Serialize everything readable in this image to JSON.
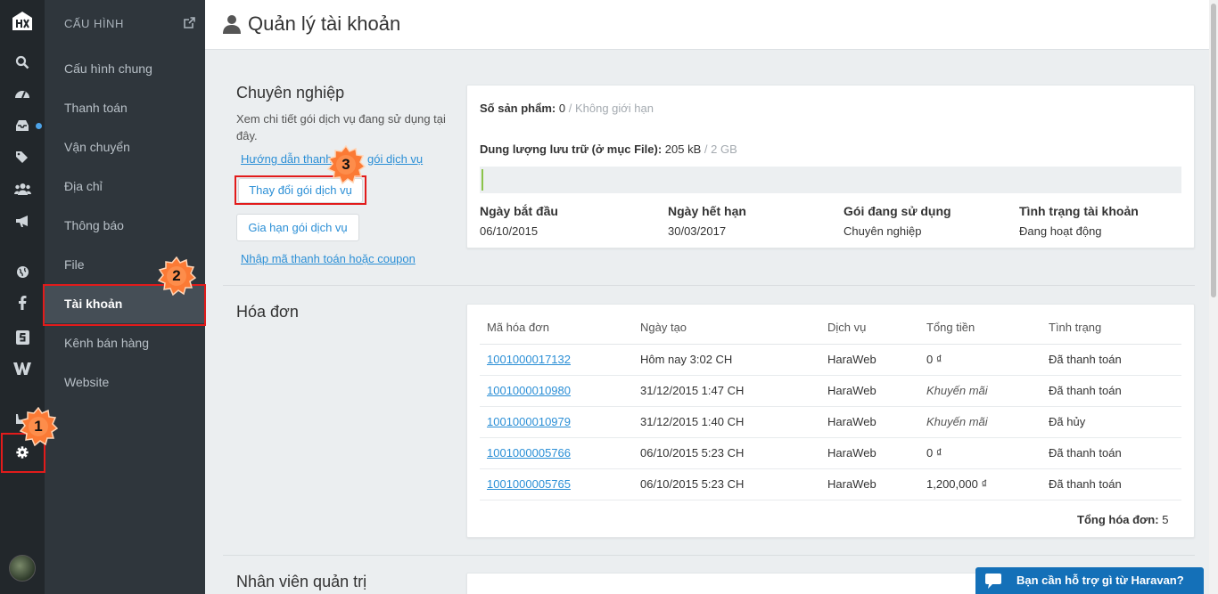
{
  "rail": {
    "icons": [
      "logo",
      "search-icon",
      "dashboard-icon",
      "inbox-icon",
      "tags-icon",
      "users-icon",
      "megaphone-icon",
      "globe-icon",
      "facebook-icon",
      "s-icon",
      "w-icon",
      "shoe-icon",
      "gear-icon"
    ]
  },
  "submenu": {
    "header": "CẤU HÌNH",
    "items": [
      "Cấu hình chung",
      "Thanh toán",
      "Vận chuyển",
      "Địa chỉ",
      "Thông báo",
      "File",
      "Tài khoản",
      "Kênh bán hàng",
      "Website"
    ]
  },
  "page": {
    "title": "Quản lý tài khoản"
  },
  "plan": {
    "heading": "Chuyên nghiệp",
    "description": "Xem chi tiết gói dịch vụ đang sử dụng tại đây.",
    "guide_link_left": "Hướng dẫn thanh",
    "guide_link_right": "gói dịch vụ",
    "change_button": "Thay đổi gói dịch vụ",
    "renew_button": "Gia hạn gói dịch vụ",
    "coupon_link": "Nhập mã thanh toán hoặc coupon",
    "products_label": "Số sản phẩm:",
    "products_value": "0",
    "products_limit": "/ Không giới hạn",
    "storage_label": "Dung lượng lưu trữ (ở mục File):",
    "storage_value": "205 kB",
    "storage_limit": "/ 2 GB",
    "storage_fraction": 0.0001,
    "start_label": "Ngày bắt đầu",
    "start_value": "06/10/2015",
    "end_label": "Ngày hết hạn",
    "end_value": "30/03/2017",
    "package_label": "Gói đang sử dụng",
    "package_value": "Chuyên nghiệp",
    "status_label": "Tình trạng tài khoản",
    "status_value": "Đang hoạt động"
  },
  "invoices": {
    "heading": "Hóa đơn",
    "columns": [
      "Mã hóa đơn",
      "Ngày tạo",
      "Dịch vụ",
      "Tổng tiền",
      "Tình trạng"
    ],
    "rows": [
      {
        "id": "1001000017132",
        "date": "Hôm nay 3:02 CH",
        "service": "HaraWeb",
        "total": "0 ₫",
        "status": "Đã thanh toán"
      },
      {
        "id": "1001000010980",
        "date": "31/12/2015 1:47 CH",
        "service": "HaraWeb",
        "total": "Khuyến mãi",
        "status": "Đã thanh toán"
      },
      {
        "id": "1001000010979",
        "date": "31/12/2015 1:40 CH",
        "service": "HaraWeb",
        "total": "Khuyến mãi",
        "status": "Đã hủy"
      },
      {
        "id": "1001000005766",
        "date": "06/10/2015 5:23 CH",
        "service": "HaraWeb",
        "total": "0 ₫",
        "status": "Đã thanh toán"
      },
      {
        "id": "1001000005765",
        "date": "06/10/2015 5:23 CH",
        "service": "HaraWeb",
        "total": "1,200,000 ₫",
        "status": "Đã thanh toán"
      }
    ],
    "total_label": "Tổng hóa đơn:",
    "total_value": "5"
  },
  "staff": {
    "heading": "Nhân viên quản trị"
  },
  "badges": [
    "1",
    "2",
    "3"
  ],
  "chat": {
    "label": "Bạn cần hỗ trợ gì từ Haravan?"
  },
  "colors": {
    "highlight": "#e21b1b",
    "link": "#2b8fd6",
    "badge_fill": "#fb7a35"
  }
}
